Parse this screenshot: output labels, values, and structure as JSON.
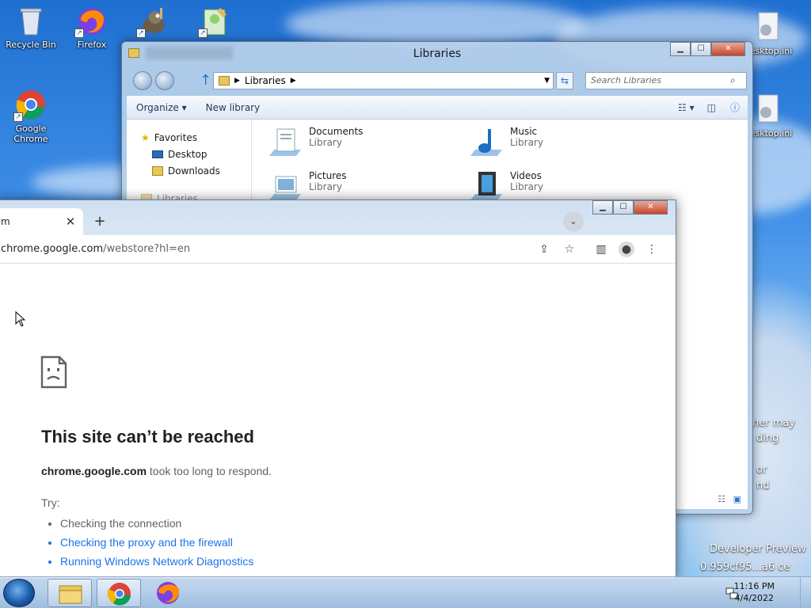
{
  "desktop": {
    "icons": [
      {
        "label": "Recycle Bin"
      },
      {
        "label": "Firefox"
      },
      {
        "label": ""
      },
      {
        "label": ""
      },
      {
        "label": "Google Chrome"
      },
      {
        "label": "desktop.ini"
      },
      {
        "label": "desktop.ini"
      }
    ],
    "watermark": {
      "line1": "her may",
      "line2": "ding",
      "line3": "or",
      "line4": "nd",
      "line5": "Developer Preview",
      "line6": "0.959cf95...a6 ce"
    }
  },
  "explorer": {
    "title": "Libraries",
    "blurred_title": "",
    "breadcrumb": "Libraries",
    "search_placeholder": "Search Libraries",
    "toolbar": {
      "organize": "Organize",
      "new_library": "New library"
    },
    "nav": {
      "favorites": "Favorites",
      "desktop": "Desktop",
      "downloads": "Downloads",
      "libraries": "Libraries"
    },
    "libraries": [
      {
        "name": "Documents",
        "sub": "Library"
      },
      {
        "name": "Music",
        "sub": "Library"
      },
      {
        "name": "Pictures",
        "sub": "Library"
      },
      {
        "name": "Videos",
        "sub": "Library"
      }
    ]
  },
  "chrome": {
    "tab_title": "m",
    "url_host": "chrome.google.com",
    "url_path": "/webstore?hl=en",
    "error": {
      "title": "This site can’t be reached",
      "host": "chrome.google.com",
      "message": "took too long to respond.",
      "try_label": "Try:",
      "suggestions": [
        "Checking the connection",
        "Checking the proxy and the firewall",
        "Running Windows Network Diagnostics"
      ]
    }
  },
  "taskbar": {
    "time": "11:16 PM",
    "date": "4/4/2022"
  },
  "colors": {
    "link": "#1a73e8",
    "text_muted": "#5f6368",
    "accent": "#1c5aa8"
  }
}
